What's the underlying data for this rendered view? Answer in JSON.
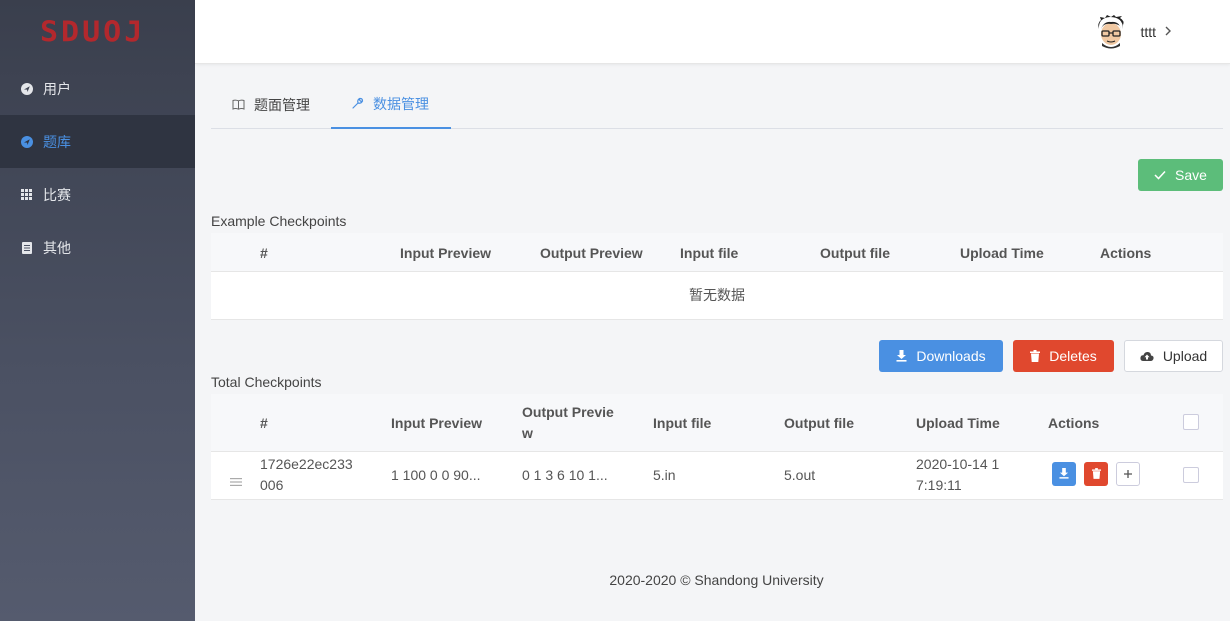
{
  "logo": {
    "text": "SDUOJ",
    "color": "#b3282d"
  },
  "sidebar": {
    "items": [
      {
        "label": "用户",
        "icon": "navigation-icon",
        "active": false
      },
      {
        "label": "题库",
        "icon": "navigation-icon",
        "active": true
      },
      {
        "label": "比赛",
        "icon": "grid-icon",
        "active": false
      },
      {
        "label": "其他",
        "icon": "document-icon",
        "active": false
      }
    ]
  },
  "header": {
    "username": "tttt",
    "avatar_icon": "cartoon-avatar"
  },
  "tabs": [
    {
      "label": "题面管理",
      "icon": "book-icon",
      "active": false
    },
    {
      "label": "数据管理",
      "icon": "wrench-icon",
      "active": true
    }
  ],
  "toolbar": {
    "save_label": "Save",
    "downloads_label": "Downloads",
    "deletes_label": "Deletes",
    "upload_label": "Upload"
  },
  "example_checkpoints": {
    "title": "Example Checkpoints",
    "columns": [
      "#",
      "Input Preview",
      "Output Preview",
      "Input file",
      "Output file",
      "Upload Time",
      "Actions"
    ],
    "empty_text": "暂无数据"
  },
  "total_checkpoints": {
    "title": "Total Checkpoints",
    "columns": [
      "#",
      "Input Preview",
      "Output Previe\nw",
      "Input file",
      "Output file",
      "Upload Time",
      "Actions"
    ],
    "rows": [
      {
        "id": "1726e22ec233\n006",
        "input_preview": "1 100 0 0 90...",
        "output_preview": "0 1 3 6 10 1...",
        "input_file": "5.in",
        "output_file": "5.out",
        "upload_time": "2020-10-14 1\n7:19:11"
      }
    ]
  },
  "footer": {
    "text": "2020-2020 © Shandong University"
  },
  "colors": {
    "primary": "#4a90e2",
    "success": "#5cbd7a",
    "danger": "#e0482e",
    "sidebar": "#3a3f4d"
  }
}
